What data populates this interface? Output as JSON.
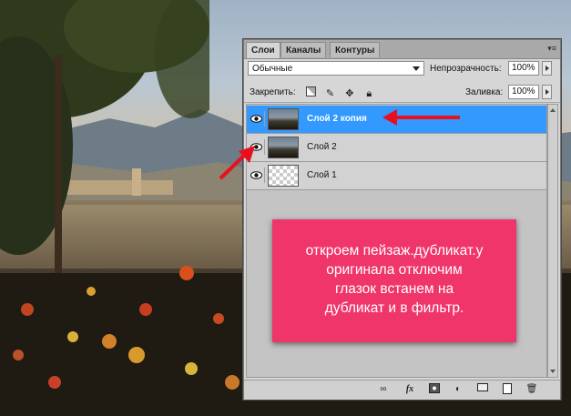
{
  "panel": {
    "tabs": [
      {
        "label": "Слои",
        "active": true
      },
      {
        "label": "Каналы",
        "active": false
      },
      {
        "label": "Контуры",
        "active": false
      }
    ],
    "menu_icon": "panel-menu-icon",
    "blend_mode": "Обычные",
    "opacity_label": "Непрозрачность:",
    "opacity_value": "100%",
    "lock_label": "Закрепить:",
    "lock_icons": [
      "lock-transparent-icon",
      "lock-paint-icon",
      "lock-move-icon",
      "lock-all-icon"
    ],
    "fill_label": "Заливка:",
    "fill_value": "100%",
    "layers": [
      {
        "name": "Слой 2 копия",
        "selected": true,
        "visible": true,
        "thumb": "photo"
      },
      {
        "name": "Слой 2",
        "selected": false,
        "visible": true,
        "thumb": "photo"
      },
      {
        "name": "Слой 1",
        "selected": false,
        "visible": true,
        "thumb": "transparent"
      }
    ],
    "footer_icons": [
      "link-layers-icon",
      "fx-icon",
      "layer-mask-icon",
      "adjustment-layer-icon",
      "new-group-icon",
      "new-layer-icon",
      "trash-icon"
    ]
  },
  "annotation": {
    "lines": [
      "откроем пейзаж.дубликат.у",
      "оригинала отключим",
      "глазок встанем на",
      "дубликат и в фильтр."
    ],
    "color": "#f0356a"
  },
  "colors": {
    "selection": "#3399ff",
    "arrow": "#e8101e"
  }
}
